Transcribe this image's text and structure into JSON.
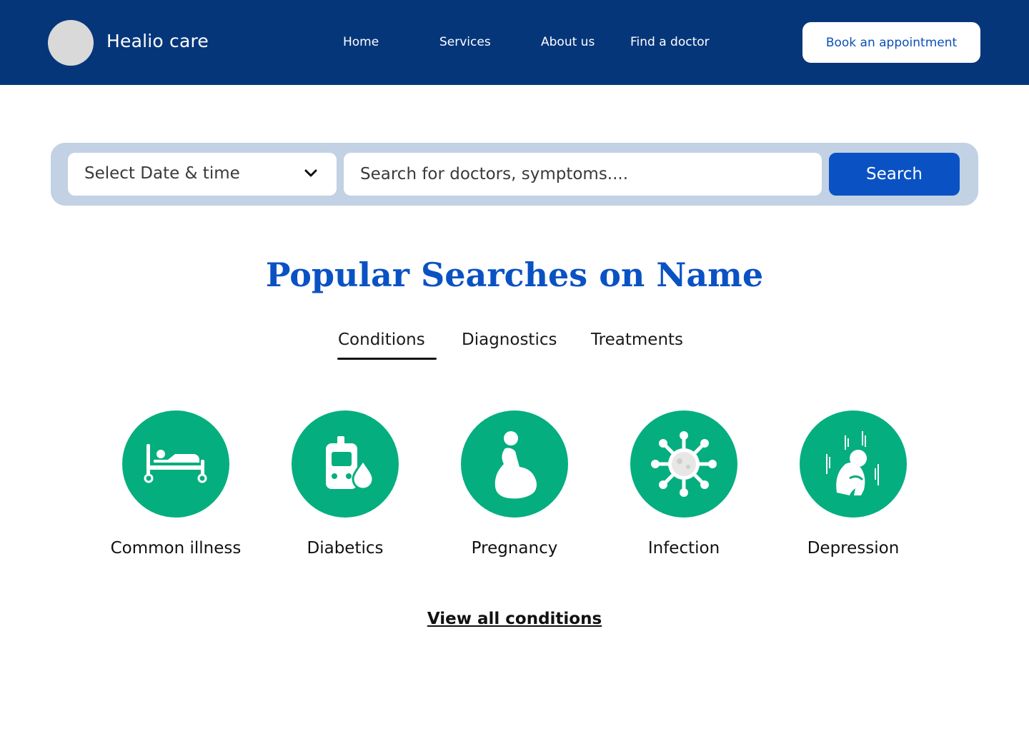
{
  "header": {
    "brand": "Healio care",
    "nav": [
      "Home",
      "Services",
      "About us",
      "Find a doctor"
    ],
    "cta": "Book an appointment"
  },
  "search": {
    "date_label": "Select Date & time",
    "placeholder": "Search for doctors, symptoms....",
    "button": "Search"
  },
  "section": {
    "title": "Popular Searches on Name",
    "tabs": [
      "Conditions",
      "Diagnostics",
      "Treatments"
    ],
    "active_tab": "Conditions"
  },
  "categories": [
    {
      "label": "Common illness",
      "icon": "hospital-bed-icon"
    },
    {
      "label": "Diabetics",
      "icon": "glucose-meter-icon"
    },
    {
      "label": "Pregnancy",
      "icon": "pregnant-woman-icon"
    },
    {
      "label": "Infection",
      "icon": "virus-icon"
    },
    {
      "label": "Depression",
      "icon": "depressed-person-icon"
    }
  ],
  "view_all": "View all conditions",
  "colors": {
    "header_bg": "#06367a",
    "accent": "#0a52c4",
    "category_green": "#05ae7f",
    "search_wrap_bg": "#c2d1e3"
  }
}
